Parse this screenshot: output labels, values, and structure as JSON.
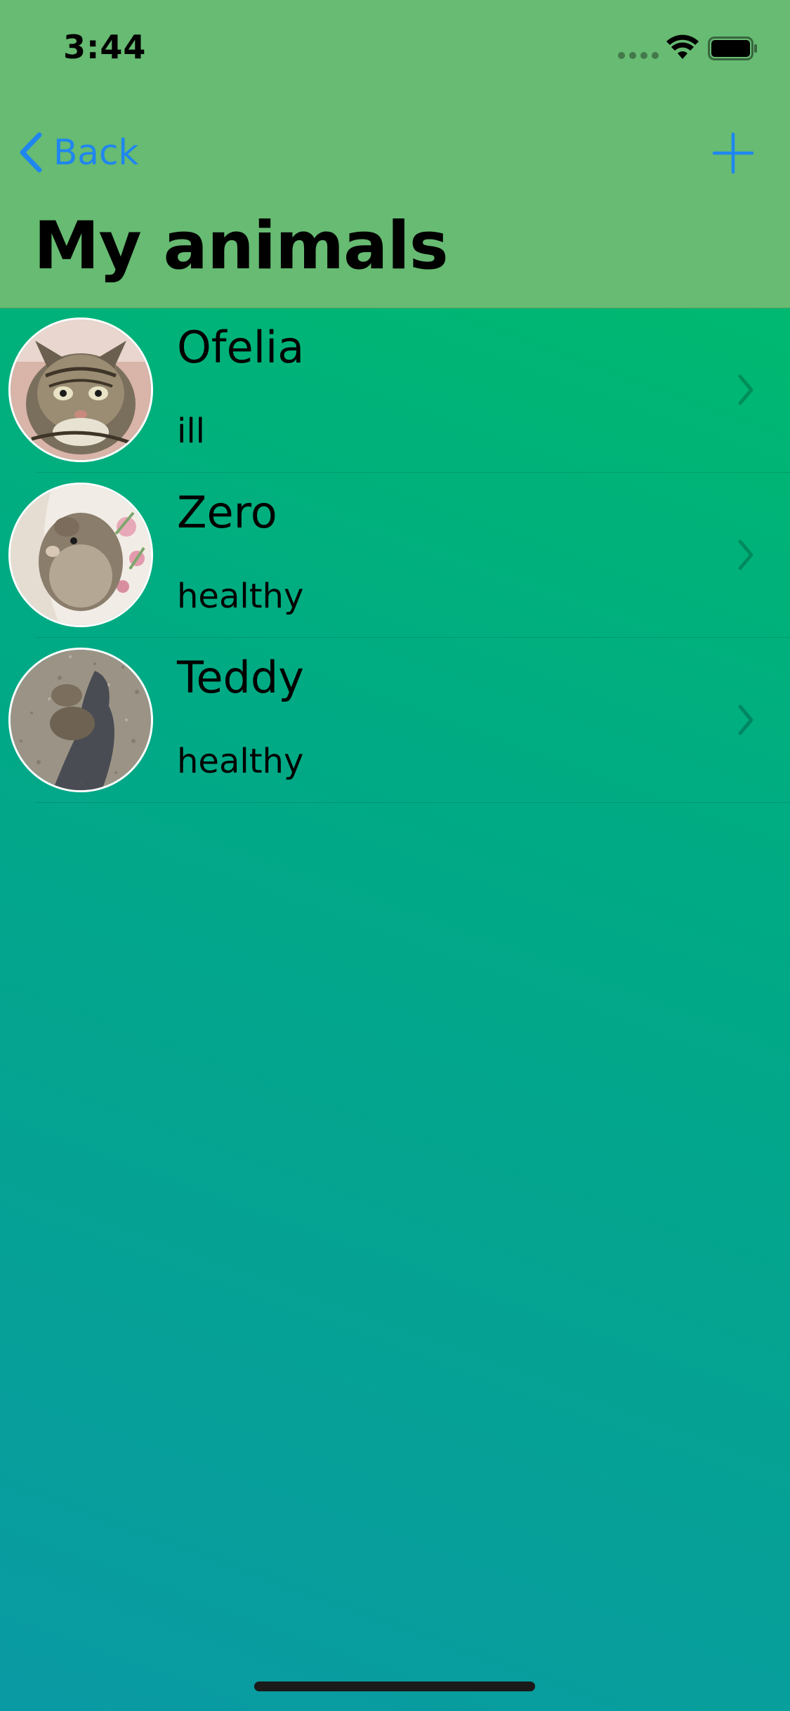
{
  "status_bar": {
    "time": "3:44"
  },
  "nav": {
    "back_label": "Back",
    "title": "My animals"
  },
  "animals": [
    {
      "name": "Ofelia",
      "status": "ill"
    },
    {
      "name": "Zero",
      "status": "healthy"
    },
    {
      "name": "Teddy",
      "status": "healthy"
    }
  ],
  "colors": {
    "nav_background": "#67bb72",
    "accent": "#1f86f0"
  }
}
